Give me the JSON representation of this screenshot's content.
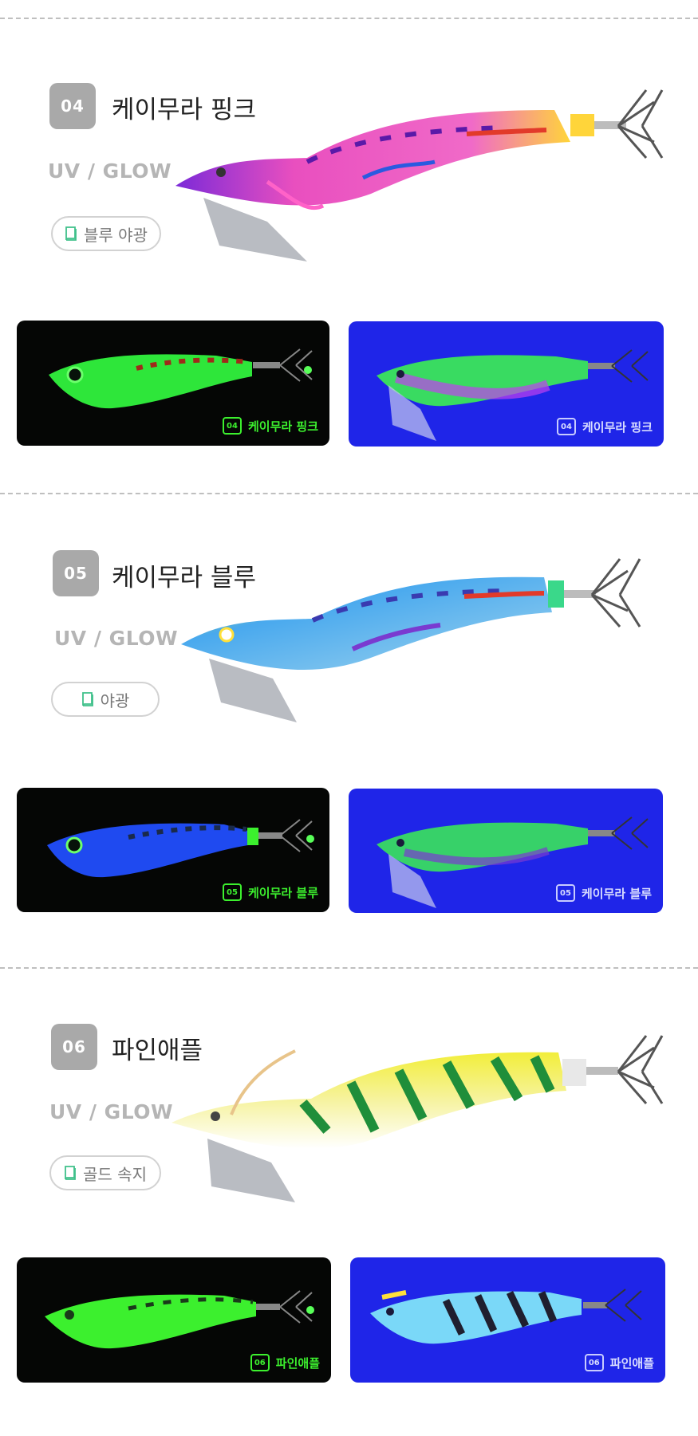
{
  "colors": {
    "badge": "#a9a9a9",
    "glow_panel": "#050605",
    "uv_panel": "#1f25e8",
    "glow_text": "#3cf02e",
    "uv_text": "#d8dcff",
    "divider": "#bfbfbf"
  },
  "products": [
    {
      "number": "04",
      "name": "케이무라 핑크",
      "type": "UV / GLOW",
      "feature": "블루 야광",
      "feature_icon": "book-icon",
      "lure_colors": [
        "#e94fbf",
        "#ffd53a",
        "#8a2ad8"
      ],
      "glow_label": "케이무라 핑크",
      "uv_label": "케이무라 핑크"
    },
    {
      "number": "05",
      "name": "케이무라 블루",
      "type": "UV / GLOW",
      "feature": "야광",
      "feature_icon": "book-icon",
      "lure_colors": [
        "#49a9ee",
        "#c6ee3a",
        "#7a3ad0"
      ],
      "glow_label": "케이무라 블루",
      "uv_label": "케이무라 블루"
    },
    {
      "number": "06",
      "name": "파인애플",
      "type": "UV / GLOW",
      "feature": "골드 속지",
      "feature_icon": "book-icon",
      "lure_colors": [
        "#f2ee3a",
        "#1f8e3a",
        "#ffffff"
      ],
      "glow_label": "파인애플",
      "uv_label": "파인애플"
    }
  ]
}
